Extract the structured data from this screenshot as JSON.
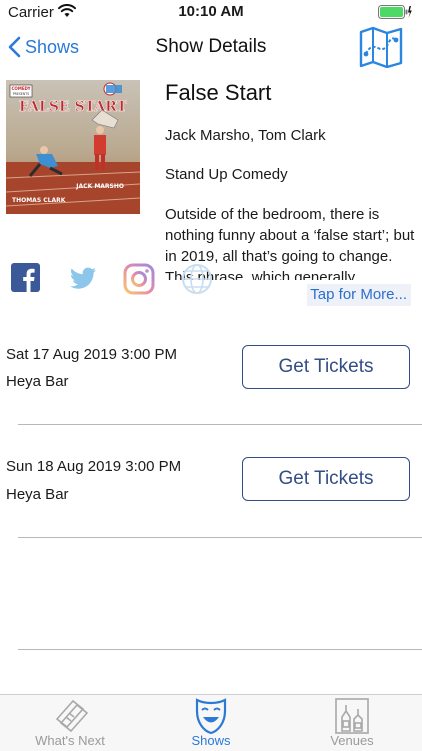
{
  "status": {
    "carrier": "Carrier",
    "time": "10:10 AM"
  },
  "nav": {
    "back_label": "Shows",
    "title": "Show Details"
  },
  "show": {
    "title": "False Start",
    "performers": "Jack Marsho, Tom Clark",
    "genre": "Stand Up Comedy",
    "description": "Outside of the bedroom, there is nothing funny about a ‘false start’; but in 2019, all that’s going to change. This phrase, which generally relates...",
    "more_label": "Tap for More...",
    "poster": {
      "header_small": "COMEDY PRESENTS",
      "title": "FALSE START",
      "name1": "JACK MARSHO",
      "name2": "THOMAS CLARK",
      "badge": "FRINGE FEST"
    }
  },
  "performances": [
    {
      "date": "Sat 17 Aug 2019 3:00 PM",
      "venue": "Heya Bar",
      "button": "Get Tickets"
    },
    {
      "date": "Sun 18 Aug 2019 3:00 PM",
      "venue": "Heya Bar",
      "button": "Get Tickets"
    }
  ],
  "tabs": [
    {
      "label": "What's Next",
      "icon": "tickets-icon"
    },
    {
      "label": "Shows",
      "icon": "theatre-mask-icon"
    },
    {
      "label": "Venues",
      "icon": "bottles-icon"
    }
  ],
  "colors": {
    "accent": "#2a7ad6",
    "button_border": "#334e85",
    "battery": "#4cd964"
  }
}
